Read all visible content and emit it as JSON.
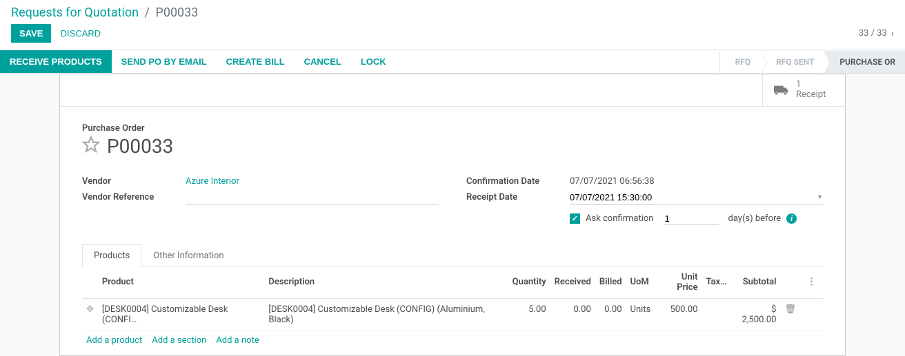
{
  "breadcrumb": {
    "main": "Requests for Quotation",
    "current": "P00033"
  },
  "controls": {
    "save": "SAVE",
    "discard": "DISCARD",
    "pager": "33 / 33"
  },
  "statusbar": {
    "buttons": {
      "receive": "RECEIVE PRODUCTS",
      "send": "SEND PO BY EMAIL",
      "bill": "CREATE BILL",
      "cancel": "CANCEL",
      "lock": "LOCK"
    },
    "steps": {
      "rfq": "RFQ",
      "rfq_sent": "RFQ SENT",
      "po": "PURCHASE OR"
    }
  },
  "stat": {
    "receipt_count": "1",
    "receipt_label": "Receipt"
  },
  "title": {
    "label": "Purchase Order",
    "name": "P00033"
  },
  "fields": {
    "vendor_label": "Vendor",
    "vendor_value": "Azure Interior",
    "vendor_ref_label": "Vendor Reference",
    "vendor_ref_value": "",
    "conf_date_label": "Confirmation Date",
    "conf_date_value": "07/07/2021 06:56:38",
    "receipt_date_label": "Receipt Date",
    "receipt_date_value": "07/07/2021 15:30:00",
    "ask_conf_label": "Ask confirmation",
    "days_value": "1",
    "days_suffix": "day(s) before"
  },
  "tabs": {
    "products": "Products",
    "other": "Other Information"
  },
  "table": {
    "headers": {
      "product": "Product",
      "description": "Description",
      "quantity": "Quantity",
      "received": "Received",
      "billed": "Billed",
      "uom": "UoM",
      "unit_price": "Unit Price",
      "taxes": "Tax…",
      "subtotal": "Subtotal"
    },
    "rows": [
      {
        "product": "[DESK0004] Customizable Desk (CONFI…",
        "description": "[DESK0004] Customizable Desk (CONFIG) (Aluminium, Black)",
        "quantity": "5.00",
        "received": "0.00",
        "billed": "0.00",
        "uom": "Units",
        "unit_price": "500.00",
        "taxes": "",
        "subtotal": "$ 2,500.00"
      }
    ],
    "actions": {
      "add_product": "Add a product",
      "add_section": "Add a section",
      "add_note": "Add a note"
    }
  }
}
